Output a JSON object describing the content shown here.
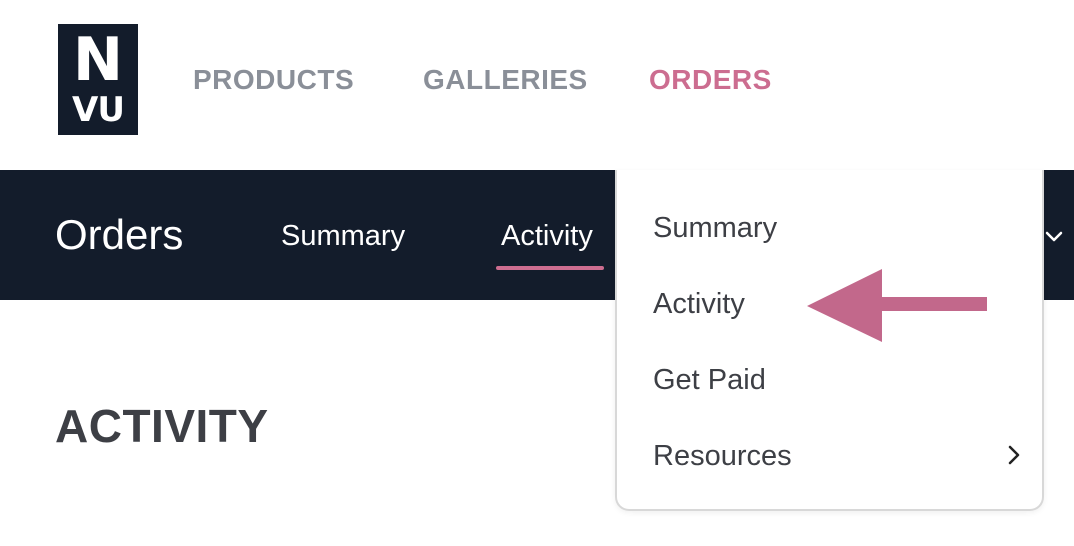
{
  "logo": {
    "line1": "N",
    "line2": "VU"
  },
  "top_nav": [
    {
      "label": "PRODUCTS",
      "active": false
    },
    {
      "label": "GALLERIES",
      "active": false
    },
    {
      "label": "ORDERS",
      "active": true
    }
  ],
  "sub_nav": {
    "title": "Orders",
    "items": [
      {
        "label": "Summary"
      },
      {
        "label": "Activity",
        "active": true
      }
    ],
    "chevron": "chevron-down-icon"
  },
  "page_heading": "ACTIVITY",
  "dropdown": {
    "items": [
      {
        "label": "Summary"
      },
      {
        "label": "Activity",
        "highlighted": true
      },
      {
        "label": "Get Paid"
      },
      {
        "label": "Resources",
        "has_submenu": true
      }
    ],
    "submenu_icon": "chevron-right-icon"
  },
  "annotation": {
    "type": "arrow",
    "color": "#c2688b",
    "points_to": "Activity"
  },
  "colors": {
    "navy": "#131c2b",
    "accent_pink": "#cc6d90",
    "nav_gray": "#8a8f98",
    "text_dark": "#3d3f45"
  }
}
